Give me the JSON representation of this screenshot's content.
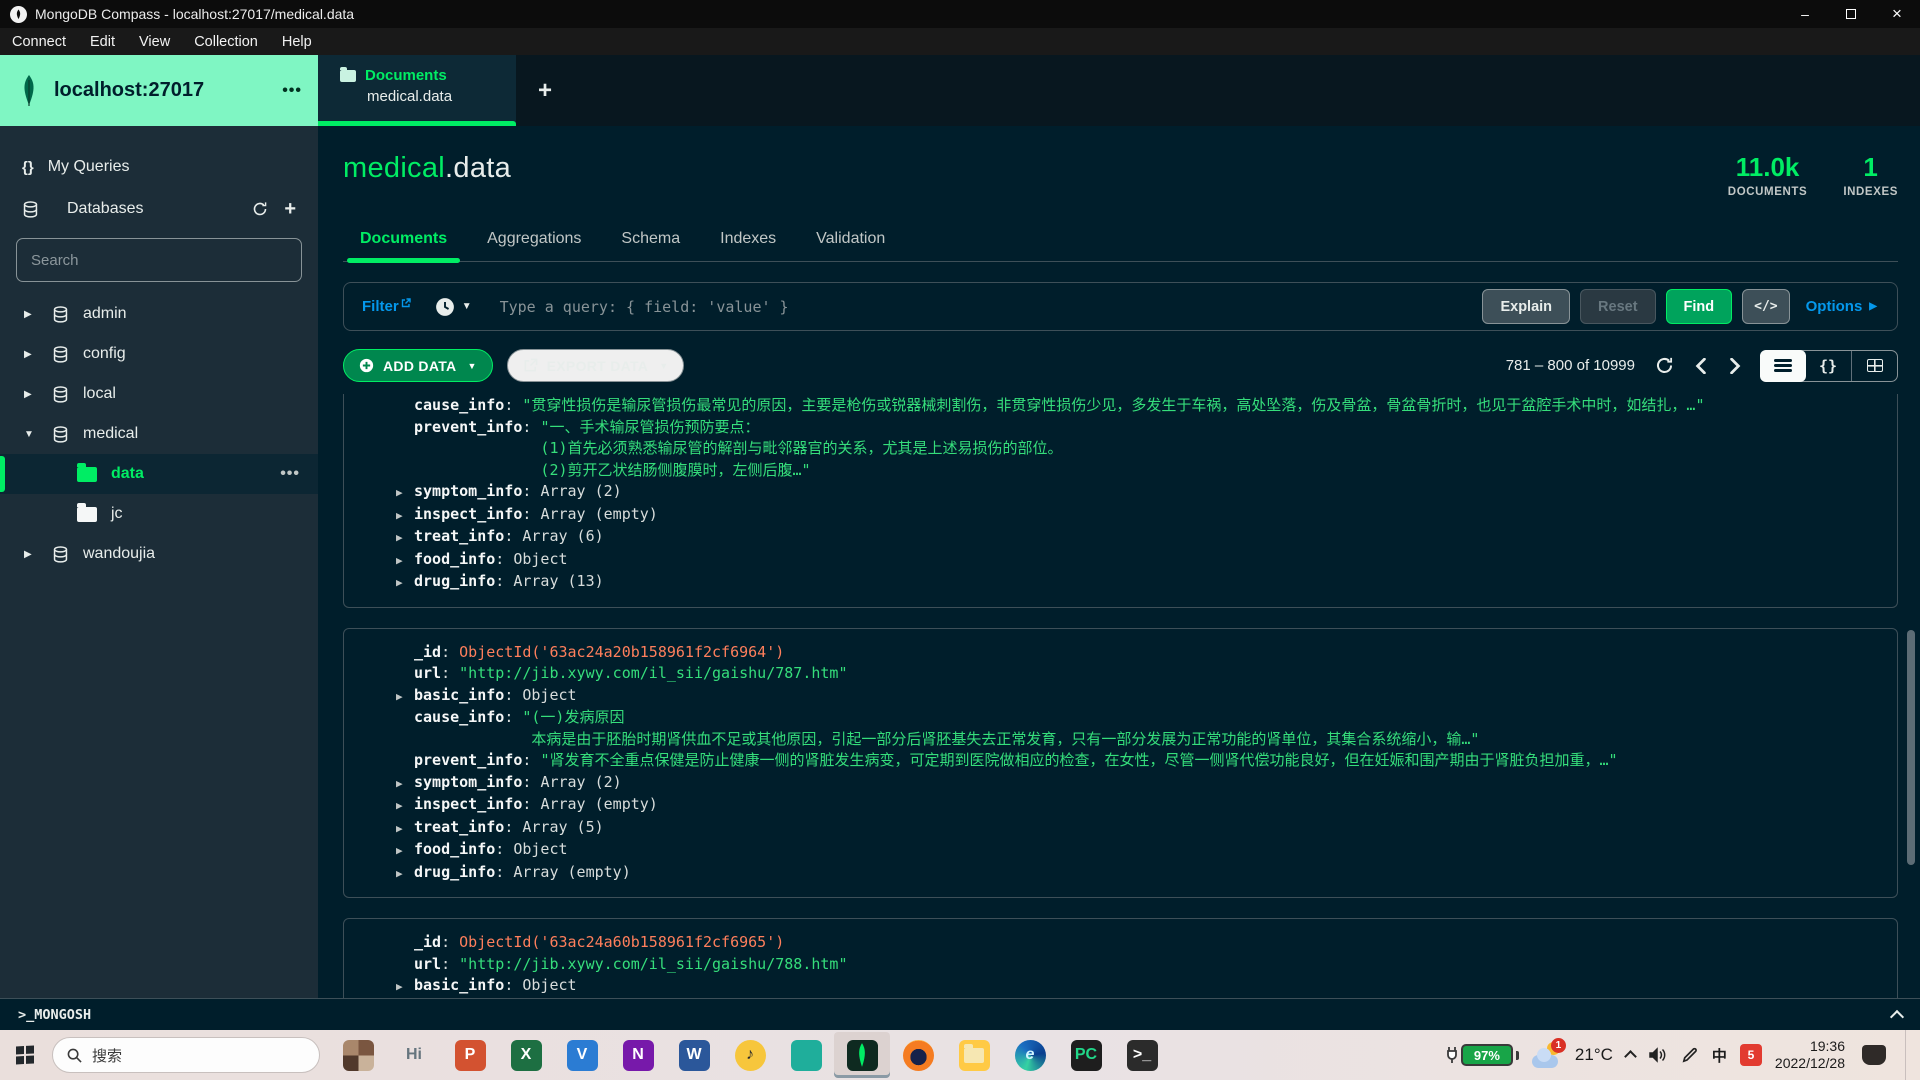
{
  "window": {
    "title": "MongoDB Compass - localhost:27017/medical.data",
    "menu": [
      "Connect",
      "Edit",
      "View",
      "Collection",
      "Help"
    ]
  },
  "sidebar": {
    "server": "localhost:27017",
    "ellipsis": "•••",
    "my_queries_label": "My Queries",
    "databases_label": "Databases",
    "search_placeholder": "Search",
    "tree": [
      {
        "type": "db",
        "label": "admin",
        "expanded": false
      },
      {
        "type": "db",
        "label": "config",
        "expanded": false
      },
      {
        "type": "db",
        "label": "local",
        "expanded": false
      },
      {
        "type": "db",
        "label": "medical",
        "expanded": true
      },
      {
        "type": "coll",
        "label": "data",
        "active": true,
        "ellipsis": "•••"
      },
      {
        "type": "coll",
        "label": "jc",
        "active": false
      },
      {
        "type": "db",
        "label": "wandoujia",
        "expanded": false
      }
    ]
  },
  "tabstrip": {
    "tab_title": "Documents",
    "tab_subtitle": "medical.data",
    "new_tab": "+"
  },
  "collection_header": {
    "namespace_db": "medical",
    "namespace_rest": ".data",
    "stats": [
      {
        "value": "11.0k",
        "label": "DOCUMENTS"
      },
      {
        "value": "1",
        "label": "INDEXES"
      }
    ]
  },
  "view_tabs": [
    {
      "label": "Documents",
      "active": true
    },
    {
      "label": "Aggregations",
      "active": false
    },
    {
      "label": "Schema",
      "active": false
    },
    {
      "label": "Indexes",
      "active": false
    },
    {
      "label": "Validation",
      "active": false
    }
  ],
  "query_bar": {
    "filter_label": "Filter",
    "placeholder": "Type a query: { field: 'value' }",
    "explain": "Explain",
    "reset": "Reset",
    "find": "Find",
    "code_toggle": "</>",
    "options": "Options",
    "options_caret": "▶"
  },
  "toolbar": {
    "add_data": "ADD DATA",
    "export_data": "EXPORT DATA",
    "range": "781 – 800 of 10999"
  },
  "documents": [
    {
      "clipped_top": true,
      "rows": [
        {
          "caret": false,
          "name": "cause_info",
          "value": {
            "type": "string",
            "text": "\"贯穿性损伤是输尿管损伤最常见的原因，主要是枪伤或锐器械刺割伤，非贯穿性损伤少见，多发生于车祸，高处坠落，伤及骨盆，骨盆骨折时，也见于盆腔手术中时，如结扎，…\""
          }
        },
        {
          "caret": false,
          "name": "prevent_info",
          "value": {
            "type": "string",
            "text": "\"一、手术输尿管损伤预防要点："
          },
          "cont": [
            {
              "indent_ch": 14,
              "text": "(1)首先必须熟悉输尿管的解剖与毗邻器官的关系，尤其是上述易损伤的部位。"
            },
            {
              "indent_ch": 14,
              "text": "(2)剪开乙状结肠侧腹膜时，左侧后腹…\""
            }
          ]
        },
        {
          "caret": true,
          "name": "symptom_info",
          "value": {
            "type": "meta",
            "text": "Array (2)"
          }
        },
        {
          "caret": true,
          "name": "inspect_info",
          "value": {
            "type": "meta",
            "text": "Array (empty)"
          }
        },
        {
          "caret": true,
          "name": "treat_info",
          "value": {
            "type": "meta",
            "text": "Array (6)"
          }
        },
        {
          "caret": true,
          "name": "food_info",
          "value": {
            "type": "meta",
            "text": "Object"
          }
        },
        {
          "caret": true,
          "name": "drug_info",
          "value": {
            "type": "meta",
            "text": "Array (13)"
          }
        }
      ]
    },
    {
      "clipped_top": false,
      "rows": [
        {
          "caret": false,
          "name": "_id",
          "value": {
            "type": "objectid",
            "text": "ObjectId('63ac24a20b158961f2cf6964')"
          }
        },
        {
          "caret": false,
          "name": "url",
          "value": {
            "type": "string",
            "text": "\"http://jib.xywy.com/il_sii/gaishu/787.htm\""
          }
        },
        {
          "caret": true,
          "name": "basic_info",
          "value": {
            "type": "meta",
            "text": "Object"
          }
        },
        {
          "caret": false,
          "name": "cause_info",
          "value": {
            "type": "string",
            "text": "\"(一)发病原因"
          },
          "cont": [
            {
              "indent_ch": 13,
              "text": "本病是由于胚胎时期肾供血不足或其他原因，引起一部分后肾胚基失去正常发育，只有一部分发展为正常功能的肾单位，其集合系统缩小，输…\""
            }
          ]
        },
        {
          "caret": false,
          "name": "prevent_info",
          "value": {
            "type": "string",
            "text": "\"肾发育不全重点保健是防止健康一侧的肾脏发生病变，可定期到医院做相应的检查，在女性，尽管一侧肾代偿功能良好，但在妊娠和围产期由于肾脏负担加重，…\""
          }
        },
        {
          "caret": true,
          "name": "symptom_info",
          "value": {
            "type": "meta",
            "text": "Array (2)"
          }
        },
        {
          "caret": true,
          "name": "inspect_info",
          "value": {
            "type": "meta",
            "text": "Array (empty)"
          }
        },
        {
          "caret": true,
          "name": "treat_info",
          "value": {
            "type": "meta",
            "text": "Array (5)"
          }
        },
        {
          "caret": true,
          "name": "food_info",
          "value": {
            "type": "meta",
            "text": "Object"
          }
        },
        {
          "caret": true,
          "name": "drug_info",
          "value": {
            "type": "meta",
            "text": "Array (empty)"
          }
        }
      ]
    },
    {
      "clipped_top": false,
      "rows": [
        {
          "caret": false,
          "name": "_id",
          "value": {
            "type": "objectid",
            "text": "ObjectId('63ac24a60b158961f2cf6965')"
          }
        },
        {
          "caret": false,
          "name": "url",
          "value": {
            "type": "string",
            "text": "\"http://jib.xywy.com/il_sii/gaishu/788.htm\""
          }
        },
        {
          "caret": true,
          "name": "basic_info",
          "value": {
            "type": "meta",
            "text": "Object"
          }
        }
      ]
    }
  ],
  "mongosh": {
    "label": ">_MONGOSH"
  },
  "taskbar": {
    "search_placeholder": "搜索",
    "apps": [
      {
        "id": "photo-thumbnail",
        "glyph": "",
        "bg": "#8A6A52",
        "fg": "#FFF"
      },
      {
        "id": "hi-app",
        "glyph": "Hi",
        "bg": "transparent",
        "fg": "#66757E"
      },
      {
        "id": "powerpoint",
        "glyph": "P",
        "bg": "#D35230",
        "fg": "#FFF"
      },
      {
        "id": "excel",
        "glyph": "X",
        "bg": "#1D6F42",
        "fg": "#FFF"
      },
      {
        "id": "video-app",
        "glyph": "V",
        "bg": "#2B7CD3",
        "fg": "#FFF"
      },
      {
        "id": "onenote",
        "glyph": "N",
        "bg": "#7719AA",
        "fg": "#FFF"
      },
      {
        "id": "word",
        "glyph": "W",
        "bg": "#2B579A",
        "fg": "#FFF"
      },
      {
        "id": "music-app",
        "glyph": "♪",
        "bg": "#F7C63C",
        "fg": "#2B2B2B"
      },
      {
        "id": "green-app",
        "glyph": "",
        "bg": "#1FAE9B",
        "fg": "#FFF"
      },
      {
        "id": "mongodb-compass",
        "glyph": "leaf",
        "bg": "#0E2A20",
        "fg": "#00ED64",
        "active": true
      },
      {
        "id": "firefox",
        "glyph": "",
        "bg": "#17224A",
        "fg": "#F57C21"
      },
      {
        "id": "file-explorer",
        "glyph": "folder",
        "bg": "#FFCA45",
        "fg": "#B98A1E"
      },
      {
        "id": "edge",
        "glyph": "e",
        "bg": "#1B6EC2",
        "fg": "#CFF5FF"
      },
      {
        "id": "pycharm",
        "glyph": "PC",
        "bg": "#1E1E1E",
        "fg": "#21D789"
      },
      {
        "id": "terminal",
        "glyph": ">_",
        "bg": "#2B2B2B",
        "fg": "#FFF"
      }
    ],
    "tray": {
      "battery": "97%",
      "weather_badge": "1",
      "temperature": "21°C",
      "ime": "中",
      "red_app_glyph": "5",
      "time": "19:36",
      "date": "2022/12/28"
    }
  },
  "colors": {
    "accent_green": "#00ED64",
    "string_green": "#35DE7B",
    "objectid_orange": "#FF7F5C",
    "link_blue": "#0498EC",
    "sidebar_header_mint": "#7FF6C3",
    "dark_bg": "#001E2B"
  }
}
